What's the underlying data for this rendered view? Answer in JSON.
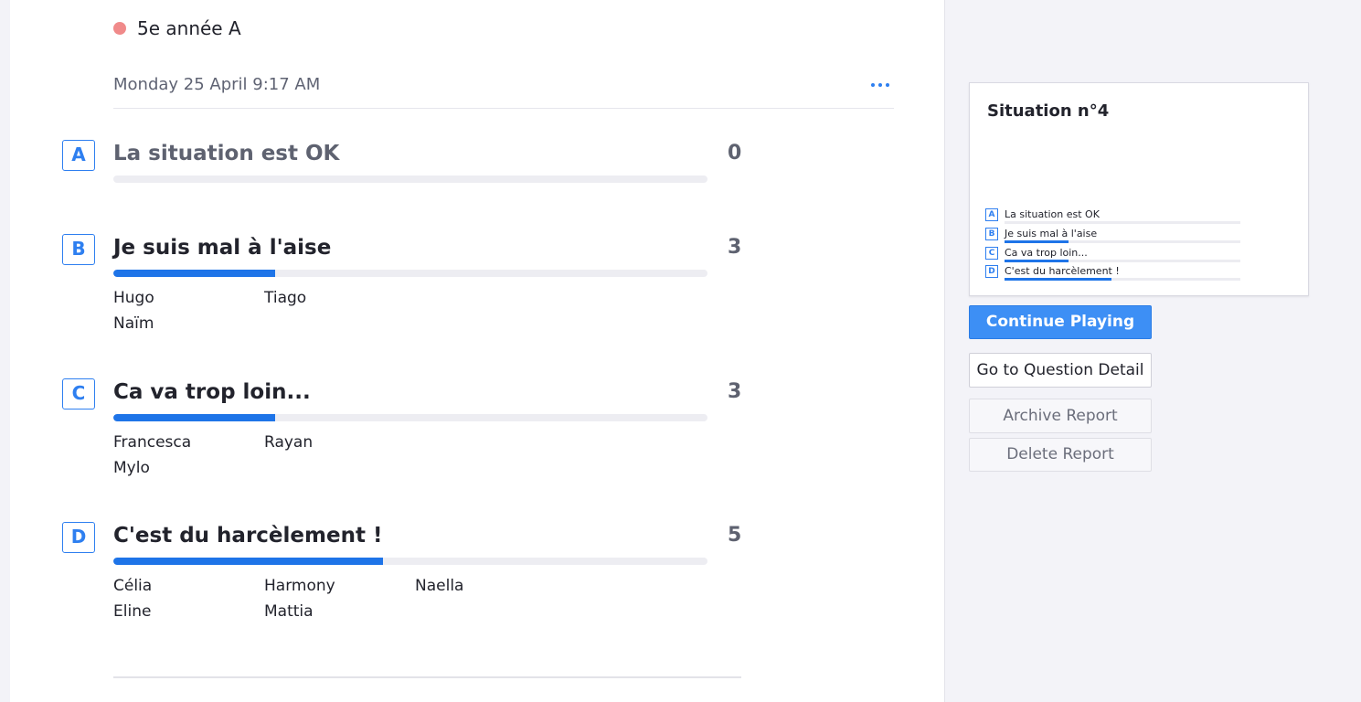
{
  "header": {
    "class_name": "5e année A",
    "class_color": "#f08a8a",
    "date": "Monday 25 April 9:17 AM",
    "more_icon": "ellipsis-icon"
  },
  "answers": [
    {
      "letter": "A",
      "label": "La situation est OK",
      "count": "0",
      "fraction": 0.0,
      "students": []
    },
    {
      "letter": "B",
      "label": "Je suis mal à l'aise",
      "count": "3",
      "fraction": 0.2727,
      "students": [
        "Hugo",
        "Tiago",
        "Naïm"
      ]
    },
    {
      "letter": "C",
      "label": "Ca va trop loin...",
      "count": "3",
      "fraction": 0.2727,
      "students": [
        "Francesca",
        "Rayan",
        "Mylo"
      ]
    },
    {
      "letter": "D",
      "label": "C'est du harcèlement !",
      "count": "5",
      "fraction": 0.4545,
      "students": [
        "Célia",
        "Harmony",
        "Naella",
        "Eline",
        "Mattia"
      ]
    }
  ],
  "preview": {
    "title": "Situation n°4",
    "items": [
      {
        "letter": "A",
        "label": "La situation est OK",
        "fraction": 0.0
      },
      {
        "letter": "B",
        "label": "Je suis mal à l'aise",
        "fraction": 0.2727
      },
      {
        "letter": "C",
        "label": "Ca va trop loin...",
        "fraction": 0.2727
      },
      {
        "letter": "D",
        "label": "C'est du harcèlement !",
        "fraction": 0.4545
      }
    ]
  },
  "actions": {
    "continue": "Continue Playing",
    "detail": "Go to Question Detail",
    "archive": "Archive Report",
    "delete": "Delete Report"
  },
  "colors": {
    "accent": "#1e74e8",
    "primary_button": "#3d8ff5",
    "class_dot": "#f08a8a"
  }
}
